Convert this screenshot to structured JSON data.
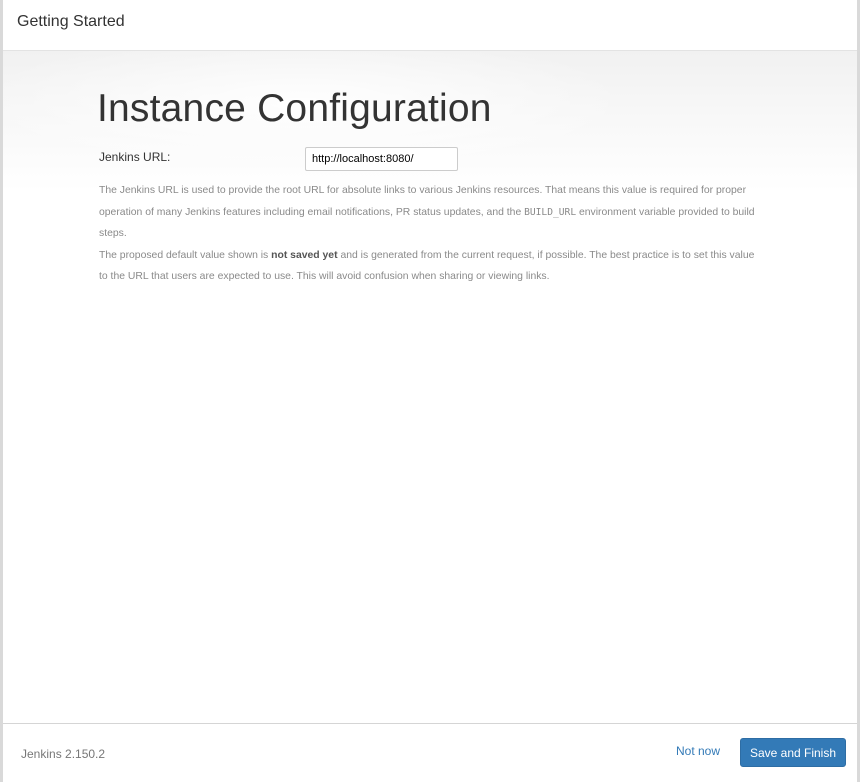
{
  "header": {
    "title": "Getting Started"
  },
  "main": {
    "page_title": "Instance Configuration",
    "jenkins_url_label": "Jenkins URL:",
    "jenkins_url_value": "http://localhost:8080/",
    "help": {
      "p1_text_before_code": "The Jenkins URL is used to provide the root URL for absolute links to various Jenkins resources. That means this value is required for proper operation of many Jenkins features including email notifications, PR status updates, and the ",
      "p1_code": "BUILD_URL",
      "p1_text_after_code": " environment variable provided to build steps.",
      "p2_text_before_bold": "The proposed default value shown is ",
      "p2_bold": "not saved yet",
      "p2_text_after_bold": " and is generated from the current request, if possible. The best practice is to set this value to the URL that users are expected to use. This will avoid confusion when sharing or viewing links."
    }
  },
  "footer": {
    "version": "Jenkins 2.150.2",
    "not_now_label": "Not now",
    "save_label": "Save and Finish"
  },
  "colors": {
    "primary_button": "#337ab7",
    "link": "#337ab7",
    "help_text": "#8a8a8a"
  }
}
